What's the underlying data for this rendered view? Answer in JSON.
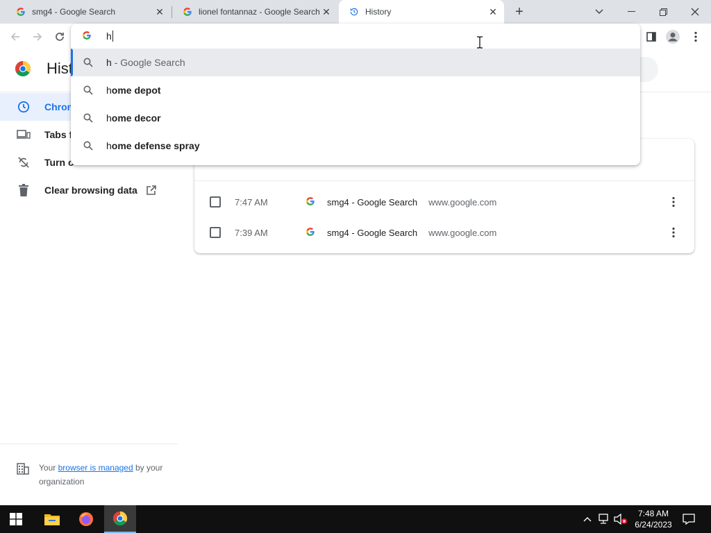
{
  "tabs": [
    {
      "title": "smg4 - Google Search",
      "icon": "google-icon"
    },
    {
      "title": "lionel fontannaz - Google Search",
      "icon": "google-icon"
    },
    {
      "title": "History",
      "icon": "history-icon"
    }
  ],
  "omnibox": {
    "value": "h",
    "suggestions": [
      {
        "typed": "h",
        "rest": "",
        "desc": " - Google Search",
        "selected": true
      },
      {
        "typed": "h",
        "rest": "ome depot",
        "desc": ""
      },
      {
        "typed": "h",
        "rest": "ome decor",
        "desc": ""
      },
      {
        "typed": "h",
        "rest": "ome defense spray",
        "desc": ""
      }
    ]
  },
  "page": {
    "title_visible": "Hist"
  },
  "sidebar": {
    "items": [
      {
        "label": "Chrom",
        "icon": "clock-icon",
        "active": true
      },
      {
        "label": "Tabs f",
        "icon": "devices-icon"
      },
      {
        "label": "Turn o",
        "icon": "sync-off-icon"
      },
      {
        "label": "Clear browsing data",
        "icon": "trash-icon"
      }
    ],
    "managed_prefix": "Your ",
    "managed_link": "browser is managed",
    "managed_suffix": " by your organization"
  },
  "history": {
    "rows": [
      {
        "time": "7:47 AM",
        "title": "smg4 - Google Search",
        "domain": "www.google.com"
      },
      {
        "time": "7:39 AM",
        "title": "smg4 - Google Search",
        "domain": "www.google.com"
      }
    ]
  },
  "taskbar": {
    "time": "7:48 AM",
    "date": "6/24/2023"
  },
  "colors": {
    "accent": "#1a73e8",
    "tabstrip": "#dee1e6",
    "taskbar": "#101010"
  }
}
